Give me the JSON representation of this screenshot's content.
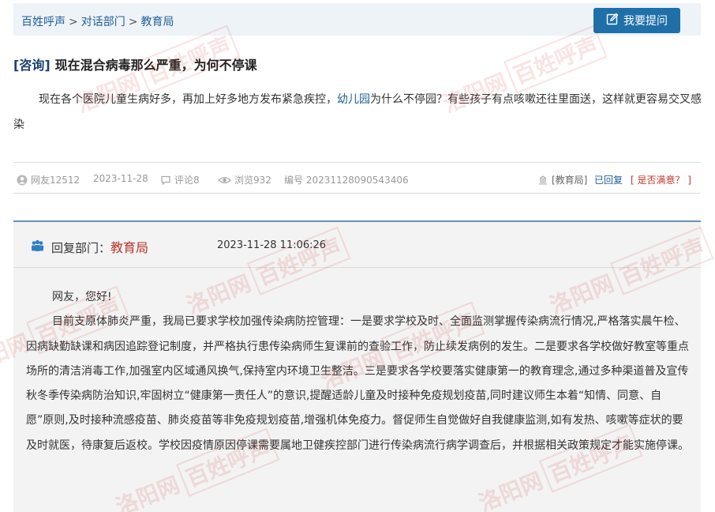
{
  "breadcrumb": {
    "items": [
      "百姓呼声",
      "对话部门",
      "教育局"
    ],
    "separator": ">"
  },
  "ask_button": {
    "label": "我要提问",
    "icon": "edit-icon"
  },
  "question": {
    "tag": "[咨询]",
    "title": "现在混合病毒那么严重，为何不停课",
    "body_before": "现在各个医院儿童生病好多，再加上好多地方发布紧急疾控，",
    "body_link": "幼儿园",
    "body_after": "为什么不停园？有些孩子有点咳嗽还往里面送，这样就更容易交叉感染"
  },
  "meta": {
    "user": "网友12512",
    "date": "2023-11-28",
    "comments": "评论8",
    "views": "浏览932",
    "number": "编号 20231128090543406",
    "dept": "[教育局]",
    "status": "已回复",
    "satisfied": "[ 是否满意？ ]"
  },
  "reply": {
    "label": "回复部门：",
    "dept": "教育局",
    "time": "2023-11-28 11:06:26",
    "greeting": "网友，您好!",
    "body": "目前支原体肺炎严重，我局已要求学校加强传染病防控管理：一是要求学校及时、全面监测掌握传染病流行情况,严格落实晨午检、因病缺勤缺课和病因追踪登记制度，并严格执行患传染病师生复课前的查验工作，防止续发病例的发生。二是要求各学校做好教室等重点场所的清洁消毒工作,加强室内区域通风换气,保持室内环境卫生整洁。三是要求各学校要落实健康第一的教育理念,通过多种渠道普及宣传秋冬季传染病防治知识,牢固树立“健康第一责任人”的意识,提醒适龄儿童及时接种免疫规划疫苗,同时建议师生本着“知情、同意、自愿”原则,及时接种流感疫苗、肺炎疫苗等非免疫规划疫苗,增强机体免疫力。督促师生自觉做好自我健康监测,如有发热、咳嗽等症状的要及时就医，待康复后返校。学校因疫情原因停课需要属地卫健疾控部门进行传染病流行病学调查后，并根据相关政策规定才能实施停课。"
  },
  "watermark": {
    "text": "洛阳网",
    "boxed": "百姓呼声"
  },
  "colors": {
    "link": "#1f5e96",
    "button": "#1f6fa8",
    "dept_name": "#b5342c",
    "reply_border": "#6a8fb6"
  }
}
